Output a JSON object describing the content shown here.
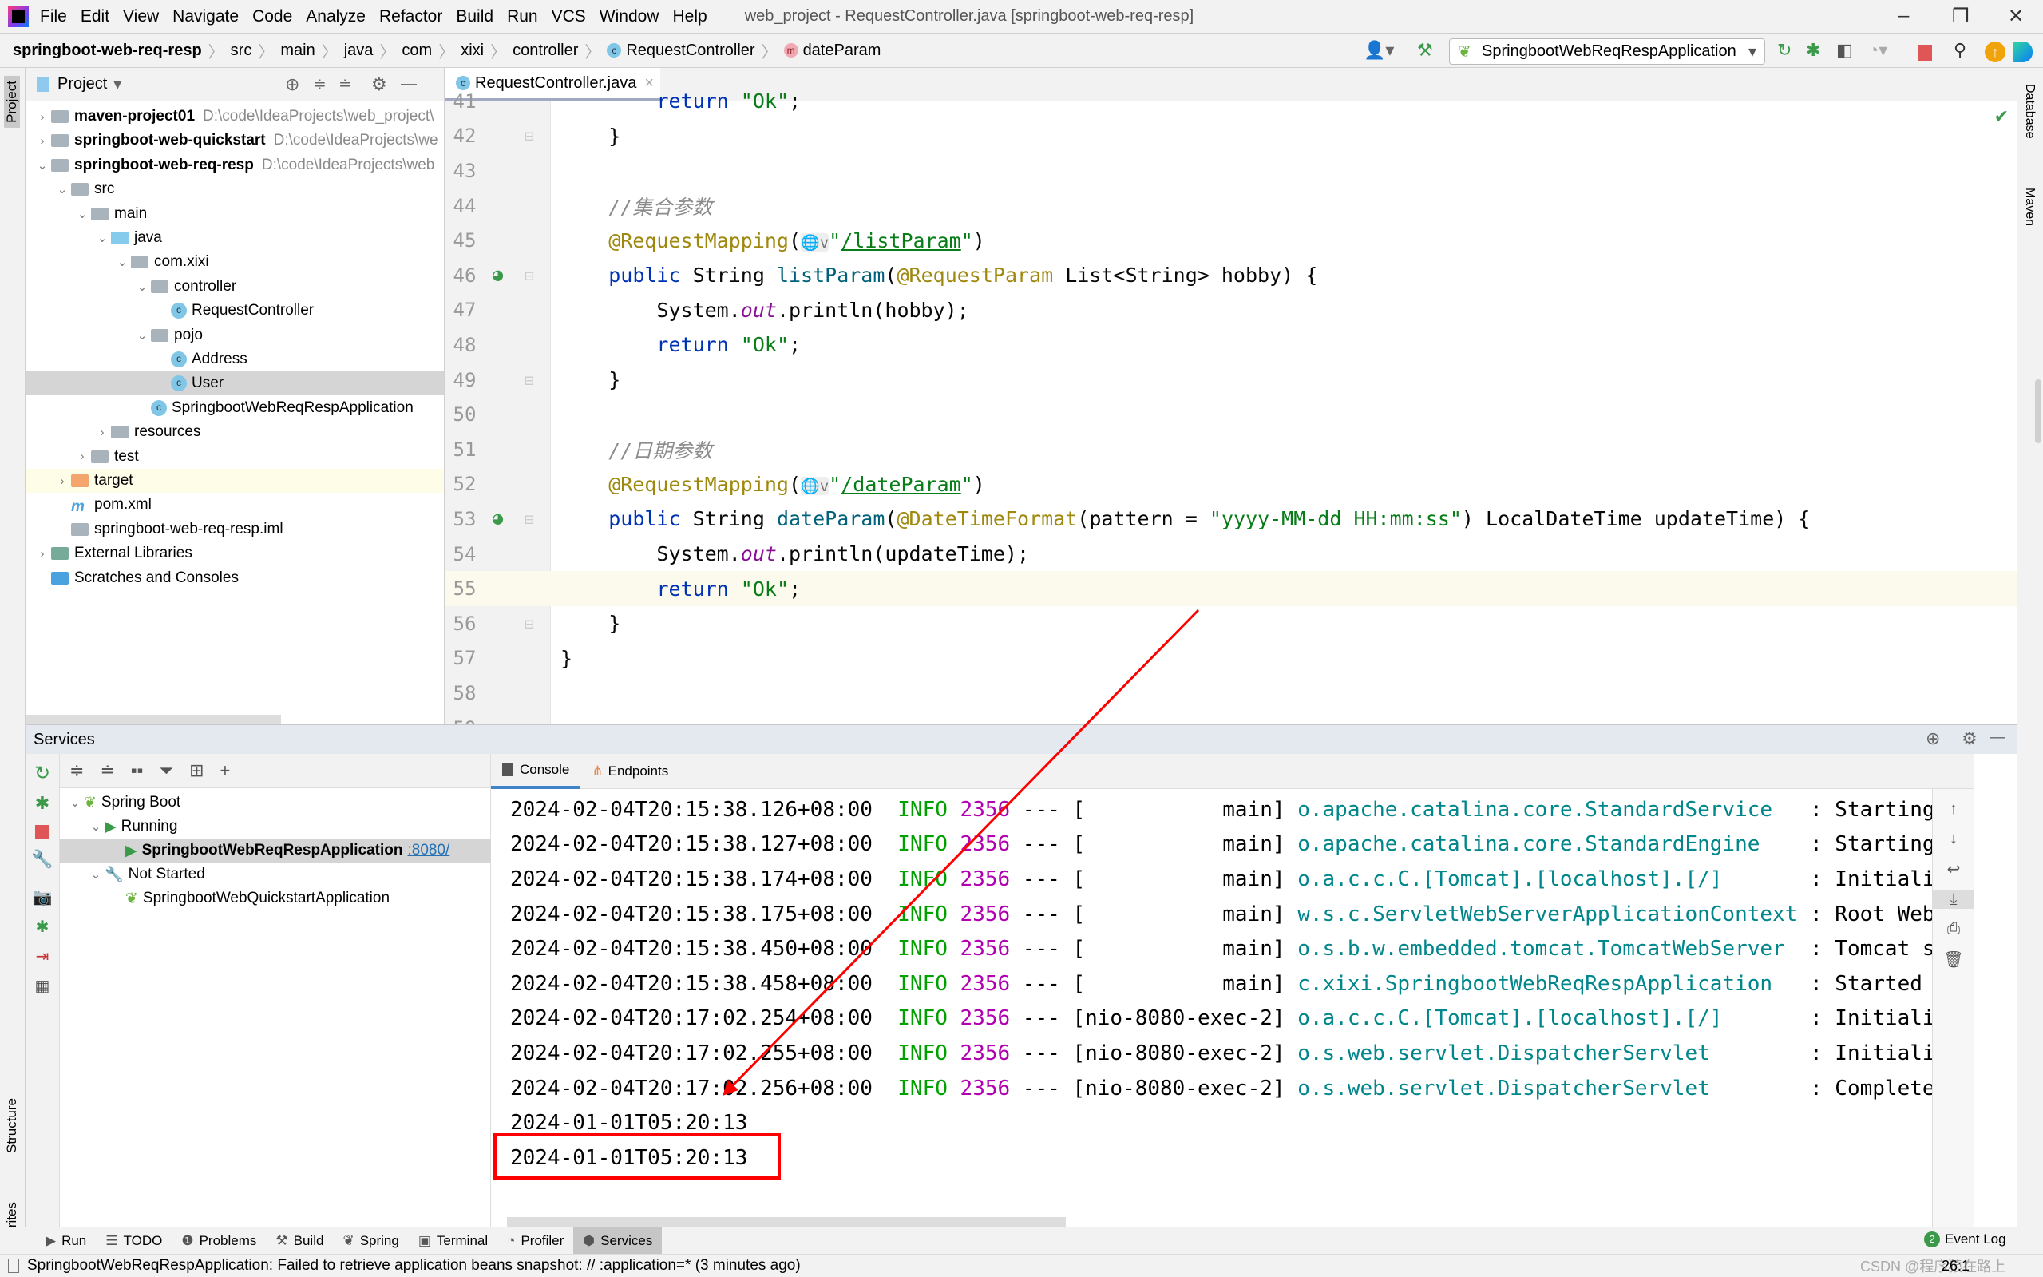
{
  "menu": {
    "items": [
      "File",
      "Edit",
      "View",
      "Navigate",
      "Code",
      "Analyze",
      "Refactor",
      "Build",
      "Run",
      "VCS",
      "Window",
      "Help"
    ],
    "title": "web_project - RequestController.java [springboot-web-req-resp]"
  },
  "breadcrumb": [
    "springboot-web-req-resp",
    "src",
    "main",
    "java",
    "com",
    "xixi",
    "controller",
    "RequestController",
    "dateParam"
  ],
  "toolbar": {
    "run_config": "SpringbootWebReqRespApplication"
  },
  "project": {
    "title": "Project",
    "tree": [
      {
        "label": "maven-project01",
        "hint": "D:\\code\\IdeaProjects\\web_project\\",
        "depth": 0,
        "arrow": ">",
        "icon": "module",
        "bold": true
      },
      {
        "label": "springboot-web-quickstart",
        "hint": "D:\\code\\IdeaProjects\\we",
        "depth": 0,
        "arrow": ">",
        "icon": "module",
        "bold": true
      },
      {
        "label": "springboot-web-req-resp",
        "hint": "D:\\code\\IdeaProjects\\web",
        "depth": 0,
        "arrow": "v",
        "icon": "module",
        "bold": true
      },
      {
        "label": "src",
        "depth": 1,
        "arrow": "v",
        "icon": "folder"
      },
      {
        "label": "main",
        "depth": 2,
        "arrow": "v",
        "icon": "folder"
      },
      {
        "label": "java",
        "depth": 3,
        "arrow": "v",
        "icon": "source-folder"
      },
      {
        "label": "com.xixi",
        "depth": 4,
        "arrow": "v",
        "icon": "package"
      },
      {
        "label": "controller",
        "depth": 5,
        "arrow": "v",
        "icon": "package"
      },
      {
        "label": "RequestController",
        "depth": 6,
        "icon": "class"
      },
      {
        "label": "pojo",
        "depth": 5,
        "arrow": "v",
        "icon": "package"
      },
      {
        "label": "Address",
        "depth": 6,
        "icon": "class"
      },
      {
        "label": "User",
        "depth": 6,
        "icon": "class",
        "selected": true
      },
      {
        "label": "SpringbootWebReqRespApplication",
        "depth": 5,
        "icon": "spring-class"
      },
      {
        "label": "resources",
        "depth": 3,
        "arrow": ">",
        "icon": "resources-folder"
      },
      {
        "label": "test",
        "depth": 2,
        "arrow": ">",
        "icon": "folder"
      },
      {
        "label": "target",
        "depth": 1,
        "arrow": ">",
        "icon": "excluded-folder",
        "highlight": true
      },
      {
        "label": "pom.xml",
        "depth": 1,
        "icon": "maven"
      },
      {
        "label": "springboot-web-req-resp.iml",
        "depth": 1,
        "icon": "iml-file"
      },
      {
        "label": "External Libraries",
        "depth": 0,
        "arrow": ">",
        "icon": "libraries"
      },
      {
        "label": "Scratches and Consoles",
        "depth": 0,
        "icon": "scratches"
      }
    ]
  },
  "editor": {
    "tab": "RequestController.java",
    "current_line": 55,
    "lines": [
      {
        "n": 41,
        "tokens": [
          {
            "t": "        ",
            "c": "plain"
          },
          {
            "t": "return",
            "c": "keyword"
          },
          {
            "t": " ",
            "c": "plain"
          },
          {
            "t": "\"Ok\"",
            "c": "string"
          },
          {
            "t": ";",
            "c": "plain"
          }
        ]
      },
      {
        "n": 42,
        "tokens": [
          {
            "t": "    }",
            "c": "plain"
          }
        ]
      },
      {
        "n": 43,
        "tokens": []
      },
      {
        "n": 44,
        "tokens": [
          {
            "t": "    //集合参数",
            "c": "comment"
          }
        ]
      },
      {
        "n": 45,
        "tokens": [
          {
            "t": "    @RequestMapping",
            "c": "annotation"
          },
          {
            "t": "(",
            "c": "plain"
          },
          {
            "t": "🌐v",
            "c": "globe"
          },
          {
            "t": "\"",
            "c": "string"
          },
          {
            "t": "/listParam",
            "c": "url"
          },
          {
            "t": "\"",
            "c": "string"
          },
          {
            "t": ")",
            "c": "plain"
          }
        ]
      },
      {
        "n": 46,
        "tokens": [
          {
            "t": "    ",
            "c": "plain"
          },
          {
            "t": "public",
            "c": "keyword"
          },
          {
            "t": " String ",
            "c": "plain"
          },
          {
            "t": "listParam",
            "c": "method"
          },
          {
            "t": "(",
            "c": "plain"
          },
          {
            "t": "@RequestParam",
            "c": "annotation"
          },
          {
            "t": " List<String> hobby) {",
            "c": "plain"
          }
        ]
      },
      {
        "n": 47,
        "tokens": [
          {
            "t": "        System.",
            "c": "plain"
          },
          {
            "t": "out",
            "c": "field"
          },
          {
            "t": ".println(hobby);",
            "c": "plain"
          }
        ]
      },
      {
        "n": 48,
        "tokens": [
          {
            "t": "        ",
            "c": "plain"
          },
          {
            "t": "return",
            "c": "keyword"
          },
          {
            "t": " ",
            "c": "plain"
          },
          {
            "t": "\"Ok\"",
            "c": "string"
          },
          {
            "t": ";",
            "c": "plain"
          }
        ]
      },
      {
        "n": 49,
        "tokens": [
          {
            "t": "    }",
            "c": "plain"
          }
        ]
      },
      {
        "n": 50,
        "tokens": []
      },
      {
        "n": 51,
        "tokens": [
          {
            "t": "    //日期参数",
            "c": "comment"
          }
        ]
      },
      {
        "n": 52,
        "tokens": [
          {
            "t": "    @RequestMapping",
            "c": "annotation"
          },
          {
            "t": "(",
            "c": "plain"
          },
          {
            "t": "🌐v",
            "c": "globe"
          },
          {
            "t": "\"",
            "c": "string"
          },
          {
            "t": "/dateParam",
            "c": "url"
          },
          {
            "t": "\"",
            "c": "string"
          },
          {
            "t": ")",
            "c": "plain"
          }
        ]
      },
      {
        "n": 53,
        "tokens": [
          {
            "t": "    ",
            "c": "plain"
          },
          {
            "t": "public",
            "c": "keyword"
          },
          {
            "t": " String ",
            "c": "plain"
          },
          {
            "t": "dateParam",
            "c": "method"
          },
          {
            "t": "(",
            "c": "plain"
          },
          {
            "t": "@DateTimeFormat",
            "c": "annotation"
          },
          {
            "t": "(pattern = ",
            "c": "plain"
          },
          {
            "t": "\"yyyy-MM-dd HH:mm:ss\"",
            "c": "string"
          },
          {
            "t": ") LocalDateTime updateTime) {",
            "c": "plain"
          }
        ]
      },
      {
        "n": 54,
        "tokens": [
          {
            "t": "        System.",
            "c": "plain"
          },
          {
            "t": "out",
            "c": "field"
          },
          {
            "t": ".println(updateTime);",
            "c": "plain"
          }
        ]
      },
      {
        "n": 55,
        "tokens": [
          {
            "t": "        ",
            "c": "plain"
          },
          {
            "t": "return",
            "c": "keyword"
          },
          {
            "t": " ",
            "c": "plain"
          },
          {
            "t": "\"Ok\"",
            "c": "string"
          },
          {
            "t": ";",
            "c": "plain"
          }
        ]
      },
      {
        "n": 56,
        "tokens": [
          {
            "t": "    }",
            "c": "plain"
          }
        ]
      },
      {
        "n": 57,
        "tokens": [
          {
            "t": "}",
            "c": "plain"
          }
        ]
      },
      {
        "n": 58,
        "tokens": []
      },
      {
        "n": 59,
        "tokens": []
      }
    ]
  },
  "right_strip": [
    "Database",
    "Maven"
  ],
  "left_strip": [
    "Project",
    "Structure",
    "Favorites"
  ],
  "services": {
    "title": "Services",
    "tree": [
      {
        "label": "Spring Boot",
        "depth": 0,
        "arrow": "v",
        "icon": "spring-boot"
      },
      {
        "label": "Running",
        "depth": 1,
        "arrow": "v",
        "icon": "run"
      },
      {
        "label": "SpringbootWebReqRespApplication",
        "link": ":8080/",
        "depth": 2,
        "icon": "run",
        "bold": true,
        "selected": true
      },
      {
        "label": "Not Started",
        "depth": 1,
        "arrow": "v",
        "icon": "wrench"
      },
      {
        "label": "SpringbootWebQuickstartApplication",
        "depth": 2,
        "icon": "spring-boot"
      }
    ],
    "console_tabs": [
      "Console",
      "Endpoints"
    ],
    "log": [
      {
        "time": "2024-02-04T20:15:38.126+08:00",
        "level": "INFO",
        "pid": "2356",
        "thread": "main",
        "logger": "o.apache.catalina.core.StandardService",
        "msg": "Starting s"
      },
      {
        "time": "2024-02-04T20:15:38.127+08:00",
        "level": "INFO",
        "pid": "2356",
        "thread": "main",
        "logger": "o.apache.catalina.core.StandardEngine",
        "msg": "Starting S"
      },
      {
        "time": "2024-02-04T20:15:38.174+08:00",
        "level": "INFO",
        "pid": "2356",
        "thread": "main",
        "logger": "o.a.c.c.C.[Tomcat].[localhost].[/]",
        "msg": "Initializ"
      },
      {
        "time": "2024-02-04T20:15:38.175+08:00",
        "level": "INFO",
        "pid": "2356",
        "thread": "main",
        "logger": "w.s.c.ServletWebServerApplicationContext",
        "msg": "Root WebAp"
      },
      {
        "time": "2024-02-04T20:15:38.450+08:00",
        "level": "INFO",
        "pid": "2356",
        "thread": "main",
        "logger": "o.s.b.w.embedded.tomcat.TomcatWebServer",
        "msg": "Tomcat sta"
      },
      {
        "time": "2024-02-04T20:15:38.458+08:00",
        "level": "INFO",
        "pid": "2356",
        "thread": "main",
        "logger": "c.xixi.SpringbootWebReqRespApplication",
        "msg": "Started Sp"
      },
      {
        "time": "2024-02-04T20:17:02.254+08:00",
        "level": "INFO",
        "pid": "2356",
        "thread": "nio-8080-exec-2",
        "logger": "o.a.c.c.C.[Tomcat].[localhost].[/]",
        "msg": "Initializ"
      },
      {
        "time": "2024-02-04T20:17:02.255+08:00",
        "level": "INFO",
        "pid": "2356",
        "thread": "nio-8080-exec-2",
        "logger": "o.s.web.servlet.DispatcherServlet",
        "msg": "Initializ"
      },
      {
        "time": "2024-02-04T20:17:02.256+08:00",
        "level": "INFO",
        "pid": "2356",
        "thread": "nio-8080-exec-2",
        "logger": "o.s.web.servlet.DispatcherServlet",
        "msg": "Completed"
      }
    ],
    "output": [
      "2024-01-01T05:20:13",
      "2024-01-01T05:20:13"
    ]
  },
  "bottom_tabs": [
    {
      "label": "Run",
      "icon": "run-icon"
    },
    {
      "label": "TODO",
      "icon": "list-icon"
    },
    {
      "label": "Problems",
      "icon": "problems-icon"
    },
    {
      "label": "Build",
      "icon": "hammer-icon"
    },
    {
      "label": "Spring",
      "icon": "leaf-icon"
    },
    {
      "label": "Terminal",
      "icon": "terminal-icon"
    },
    {
      "label": "Profiler",
      "icon": "profiler-icon"
    },
    {
      "label": "Services",
      "icon": "services-icon",
      "active": true
    }
  ],
  "event_log": {
    "label": "Event Log",
    "count": "2"
  },
  "status": {
    "message": "SpringbootWebReqRespApplication: Failed to retrieve application beans snapshot: // :application=* (3 minutes ago)",
    "position": "26:1",
    "watermark": "CSDN @程序猿在路上"
  },
  "colors": {
    "annotation_arrow": "#ff0000",
    "highlight_box": "#ff0000",
    "accent": "#4083c9"
  }
}
